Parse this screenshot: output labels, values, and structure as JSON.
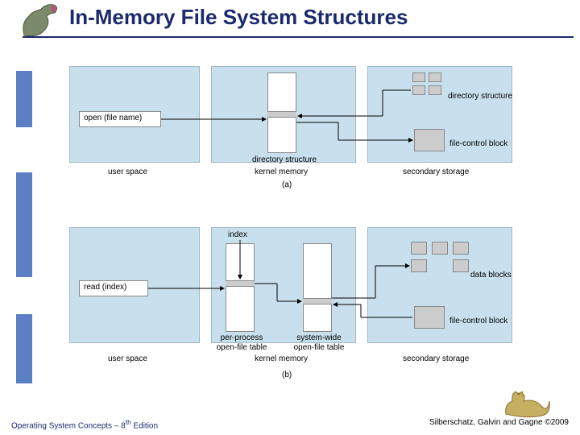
{
  "header": {
    "title": "In-Memory File System Structures"
  },
  "sidebar": {},
  "diagram_a": {
    "call_label": "open (file name)",
    "kernel_box_label": "directory structure",
    "dir_struct_label": "directory structure",
    "fcb_label": "file-control block",
    "col1": "user space",
    "col2": "kernel memory",
    "col3": "secondary storage",
    "caption": "(a)"
  },
  "diagram_b": {
    "call_label": "read (index)",
    "index_label": "index",
    "per_process_label1": "per-process",
    "per_process_label2": "open-file table",
    "system_wide_label1": "system-wide",
    "system_wide_label2": "open-file table",
    "data_blocks_label": "data blocks",
    "fcb_label": "file-control block",
    "col1": "user space",
    "col2": "kernel memory",
    "col3": "secondary storage",
    "caption": "(b)"
  },
  "footer": {
    "left": "Operating System Concepts – 8",
    "left_sup": "th",
    "left_after": " Edition",
    "right": "Silberschatz, Galvin and Gagne ©2009"
  }
}
